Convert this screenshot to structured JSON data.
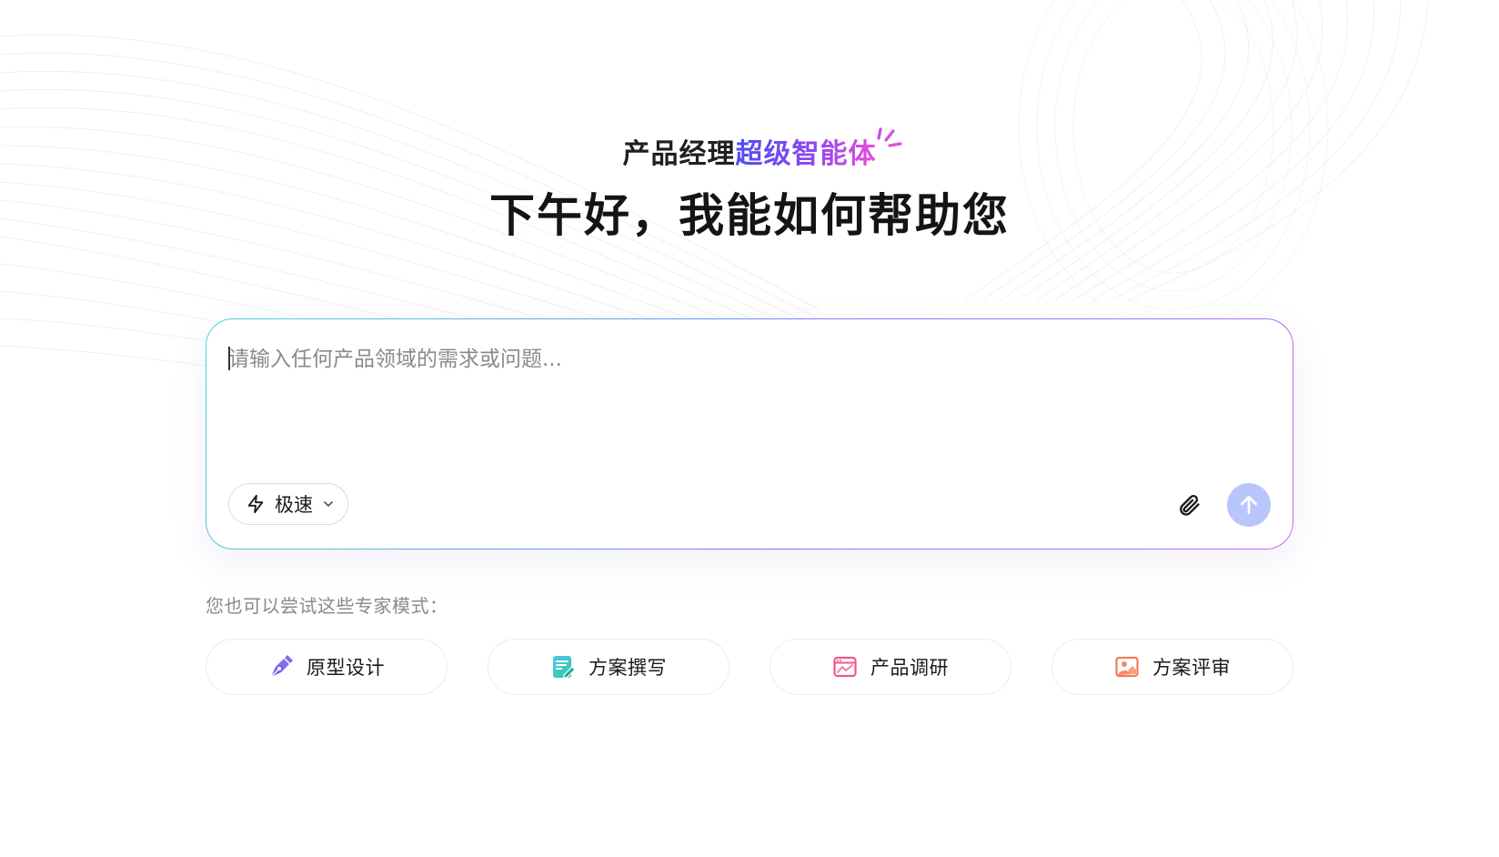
{
  "header": {
    "subtitle_plain": "产品经理",
    "subtitle_highlight": "超级智能体",
    "greeting": "下午好，我能如何帮助您"
  },
  "composer": {
    "placeholder": "请输入任何产品领域的需求或问题...",
    "value": "",
    "mode_label": "极速",
    "mode_icon": "lightning-icon",
    "attach_icon": "paperclip-icon",
    "send_icon": "arrow-up-icon"
  },
  "expert": {
    "hint": "您也可以尝试这些专家模式：",
    "modes": [
      {
        "label": "原型设计",
        "icon": "pen-nib-icon",
        "color": "#6b5cf0"
      },
      {
        "label": "方案撰写",
        "icon": "document-edit-icon",
        "color": "#3cc4c0"
      },
      {
        "label": "产品调研",
        "icon": "browser-chart-icon",
        "color": "#f0568f"
      },
      {
        "label": "方案评审",
        "icon": "image-review-icon",
        "color": "#f27a5a"
      }
    ]
  },
  "colors": {
    "accent_gradient": [
      "#4d4ff0",
      "#8a45f0",
      "#e34fd8"
    ],
    "border_gradient": [
      "#4fd6d2",
      "#7c7cf5",
      "#c56ef0"
    ],
    "send_button": "#b9c6fb"
  }
}
